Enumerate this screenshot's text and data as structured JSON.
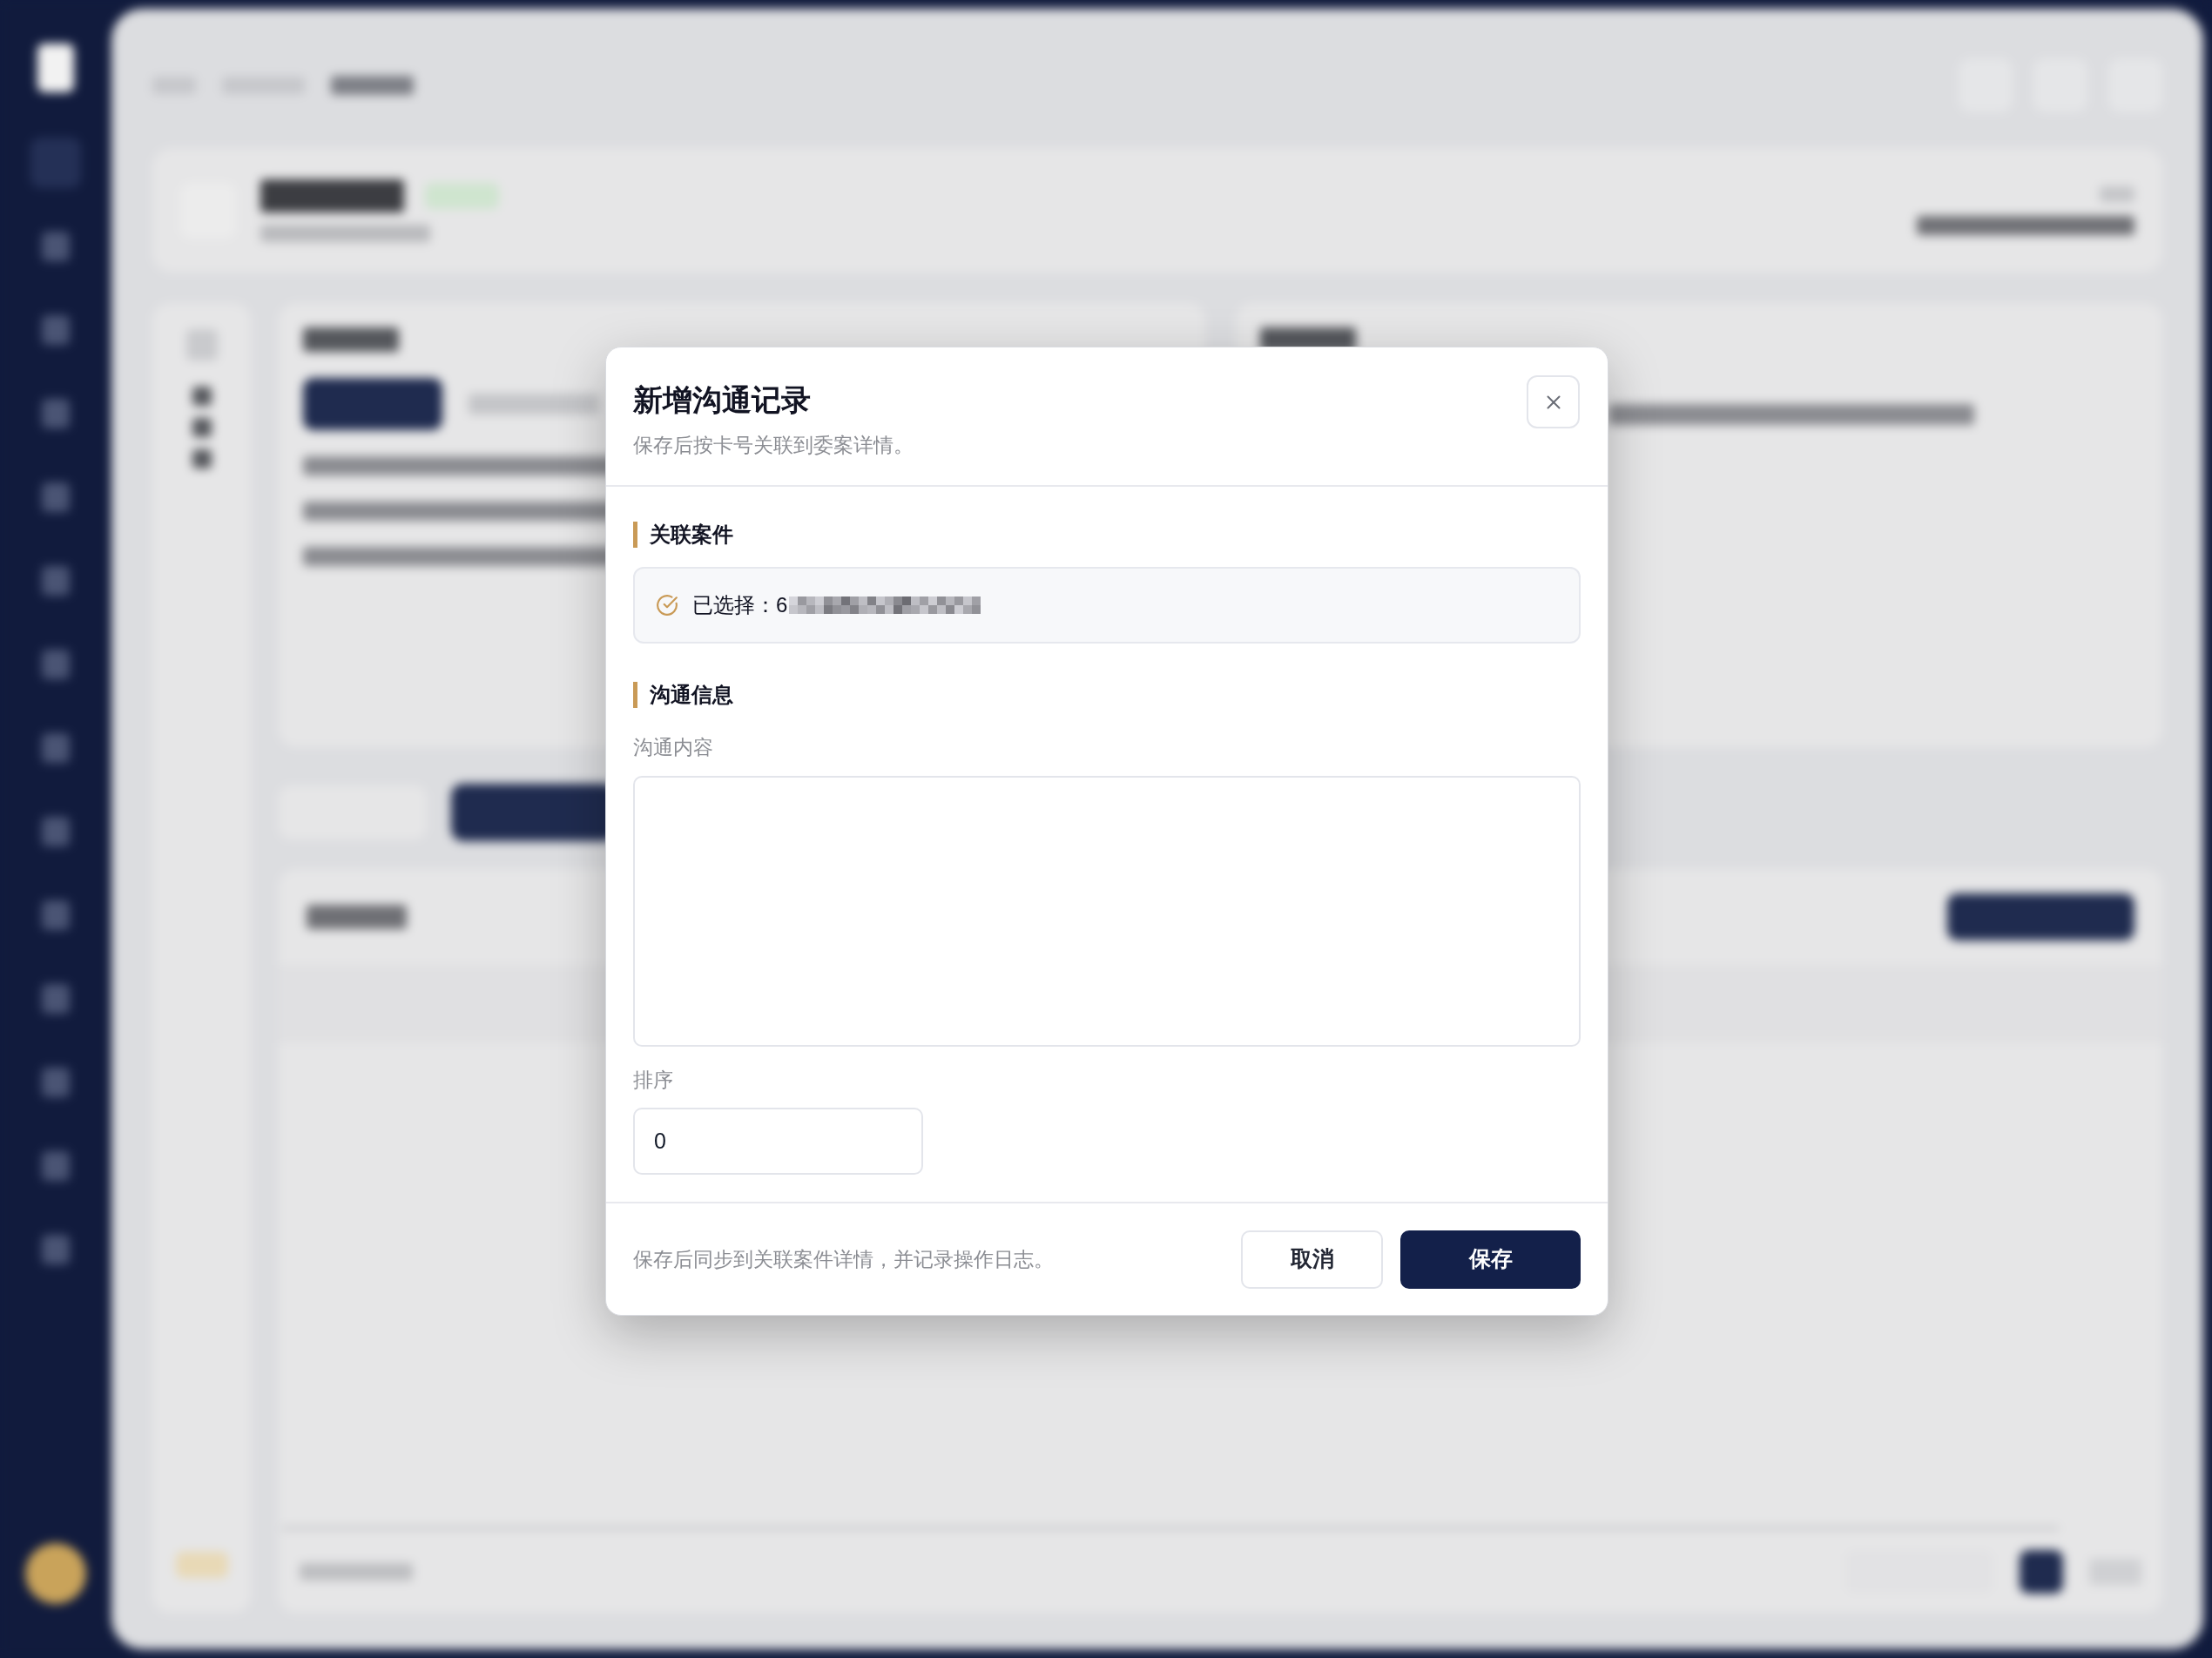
{
  "dialog": {
    "title": "新增沟通记录",
    "subtitle": "保存后按卡号关联到委案详情。"
  },
  "linked_case": {
    "heading": "关联案件",
    "selected_text": "已选择：6"
  },
  "communication": {
    "heading": "沟通信息",
    "fields": [
      {
        "kind": "textarea",
        "label": "沟通内容"
      },
      {
        "kind": "number",
        "label": "排序",
        "value": "0"
      }
    ]
  },
  "footer": {
    "note": "保存后同步到关联案件详情，并记录操作日志。",
    "buttons": [
      {
        "kind": "secondary",
        "label": "取消"
      },
      {
        "kind": "primary",
        "label": "保存"
      }
    ]
  }
}
